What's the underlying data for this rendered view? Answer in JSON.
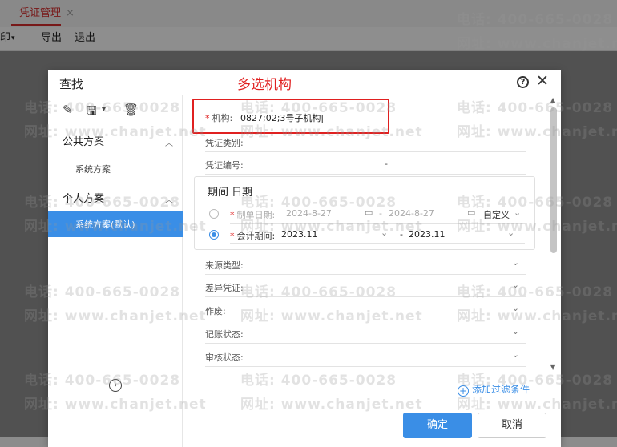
{
  "app": {
    "tab_label": "凭证管理",
    "tab_close": "×",
    "toolbar": {
      "print": "印",
      "print_arrow": "▾",
      "export": "导出",
      "exit": "退出"
    }
  },
  "watermark": {
    "phone": "电话: 400-665-0028",
    "site": "网址: www.chanjet.net"
  },
  "dialog": {
    "title": "查找",
    "annotation": "多选机构",
    "help_icon": "?",
    "close_icon": "✕",
    "left": {
      "tools": [
        "✎",
        "🖫",
        "🗑"
      ],
      "public_label": "公共方案",
      "public_items": [
        "系统方案"
      ],
      "personal_label": "个人方案",
      "personal_items": [
        "系统方案(默认)"
      ],
      "collapse": "‹"
    },
    "fields": {
      "org_label": "机构:",
      "org_value": "0827;02;3号子机构|",
      "voucher_type_label": "凭证类别:",
      "voucher_no_label": "凭证编号:",
      "voucher_no_sep": "-",
      "source_type_label": "来源类型:",
      "diff_voucher_label": "差异凭证:",
      "void_label": "作废:",
      "post_status_label": "记账状态:",
      "audit_status_label": "审核状态:"
    },
    "period": {
      "title": "期间 日期",
      "make_date_label": "制单日期:",
      "make_date_from": "2024-8-27",
      "make_date_to": "2024-8-27",
      "custom_label": "自定义",
      "acct_period_label": "会计期间:",
      "acct_period_from": "2023.11",
      "acct_period_to": "2023.11",
      "range_sep": "-"
    },
    "add_filter": "添加过滤条件",
    "ok_label": "确定",
    "cancel_label": "取消",
    "colors": {
      "accent": "#3a8ee6",
      "required": "#e02020"
    }
  }
}
